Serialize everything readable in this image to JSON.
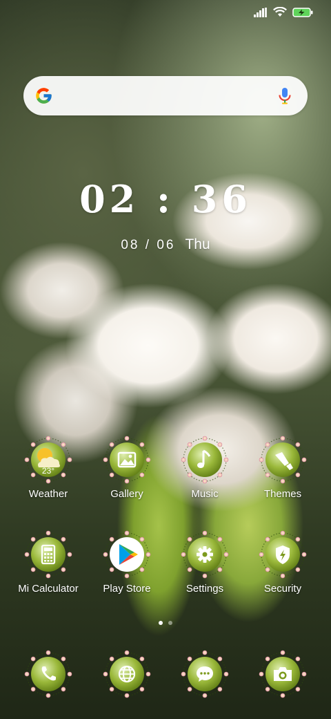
{
  "status_bar": {
    "icons": [
      "signal-icon",
      "wifi-icon",
      "battery-charging-icon"
    ]
  },
  "search": {
    "logo": "google-logo",
    "mic": "mic-icon"
  },
  "clock": {
    "time": "02 : 36",
    "date": "08 / 06",
    "weekday": "Thu"
  },
  "apps_row1": [
    {
      "label": "Weather",
      "icon": "weather-icon",
      "temp": "23°"
    },
    {
      "label": "Gallery",
      "icon": "gallery-icon"
    },
    {
      "label": "Music",
      "icon": "music-icon"
    },
    {
      "label": "Themes",
      "icon": "themes-icon"
    }
  ],
  "apps_row2": [
    {
      "label": "Mi Calculator",
      "icon": "calculator-icon"
    },
    {
      "label": "Play Store",
      "icon": "play-store-icon"
    },
    {
      "label": "Settings",
      "icon": "settings-icon"
    },
    {
      "label": "Security",
      "icon": "security-icon"
    }
  ],
  "dock": [
    {
      "icon": "phone-icon"
    },
    {
      "icon": "browser-icon"
    },
    {
      "icon": "messaging-icon"
    },
    {
      "icon": "camera-icon"
    }
  ],
  "page_indicator": {
    "pages": 2,
    "current": 1
  },
  "colors": {
    "icon_green": "#7c9a1e",
    "icon_green_light": "#d7e8a0",
    "ring_pink": "#e8a5a8"
  }
}
